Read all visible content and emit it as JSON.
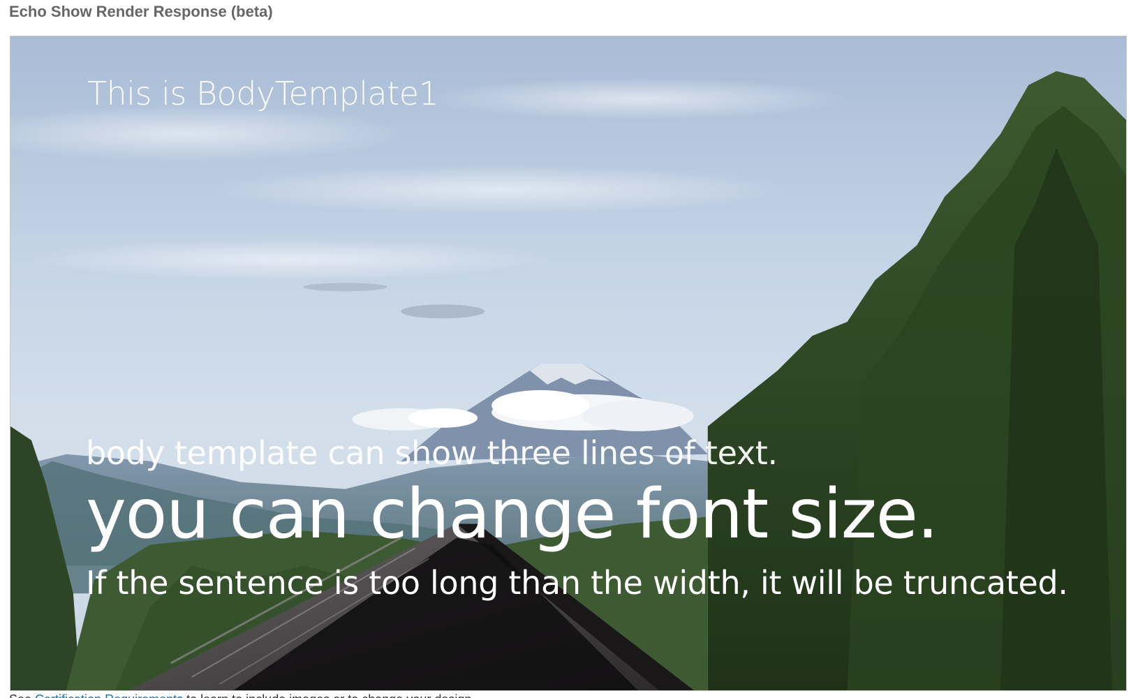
{
  "heading": "Echo Show Render Response (beta)",
  "template": {
    "title": "This is BodyTemplate1",
    "primary_text": "body template can show three lines of text.",
    "secondary_text": "you can change font size.",
    "tertiary_text": "If the sentence is too long than the width, it will be truncated."
  },
  "background": {
    "icon": "mountain-landscape-image",
    "sky_color": "#b7c9dd",
    "forest_color": "#2f4a25",
    "roof_color": "#3d3a3c"
  },
  "footer": {
    "prefix": "See ",
    "link_label": "Certification Requirements",
    "suffix": " to learn to include images or to change your design …"
  }
}
